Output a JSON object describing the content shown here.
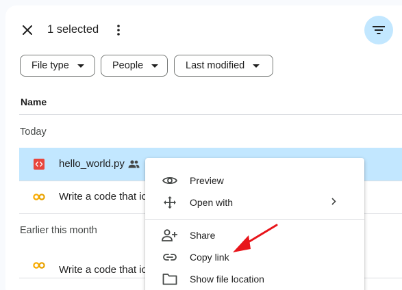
{
  "selection_bar": {
    "count_label": "1 selected",
    "close_icon": "close-icon",
    "more_icon": "more-vert-icon",
    "filter_icon": "filter-list-icon"
  },
  "filters": [
    {
      "label": "File type"
    },
    {
      "label": "People"
    },
    {
      "label": "Last modified"
    }
  ],
  "table": {
    "column_name": "Name",
    "sections": [
      {
        "label": "Today",
        "rows": [
          {
            "name": "hello_world.py",
            "icon": "code-file-icon",
            "shared": true,
            "selected": true
          },
          {
            "name": "Write a code that ic",
            "icon": "colab-icon",
            "shared": false,
            "selected": false
          }
        ]
      },
      {
        "label": "Earlier this month",
        "rows": [
          {
            "name": "Write a code that ic",
            "icon": "colab-icon",
            "shared": false,
            "selected": false
          }
        ]
      }
    ]
  },
  "context_menu": {
    "items": [
      {
        "label": "Preview",
        "icon": "eye-icon"
      },
      {
        "label": "Open with",
        "icon": "open-with-icon",
        "has_submenu": true
      },
      {
        "label": "Share",
        "icon": "person-add-icon"
      },
      {
        "label": "Copy link",
        "icon": "link-icon"
      },
      {
        "label": "Show file location",
        "icon": "folder-icon"
      }
    ]
  },
  "colors": {
    "selected_row": "#c2e7ff",
    "filter_button": "#c2e7ff",
    "annotation_arrow": "#e8141a",
    "code_file_icon": "#e8453c",
    "colab_icon": "#f9ab00"
  }
}
